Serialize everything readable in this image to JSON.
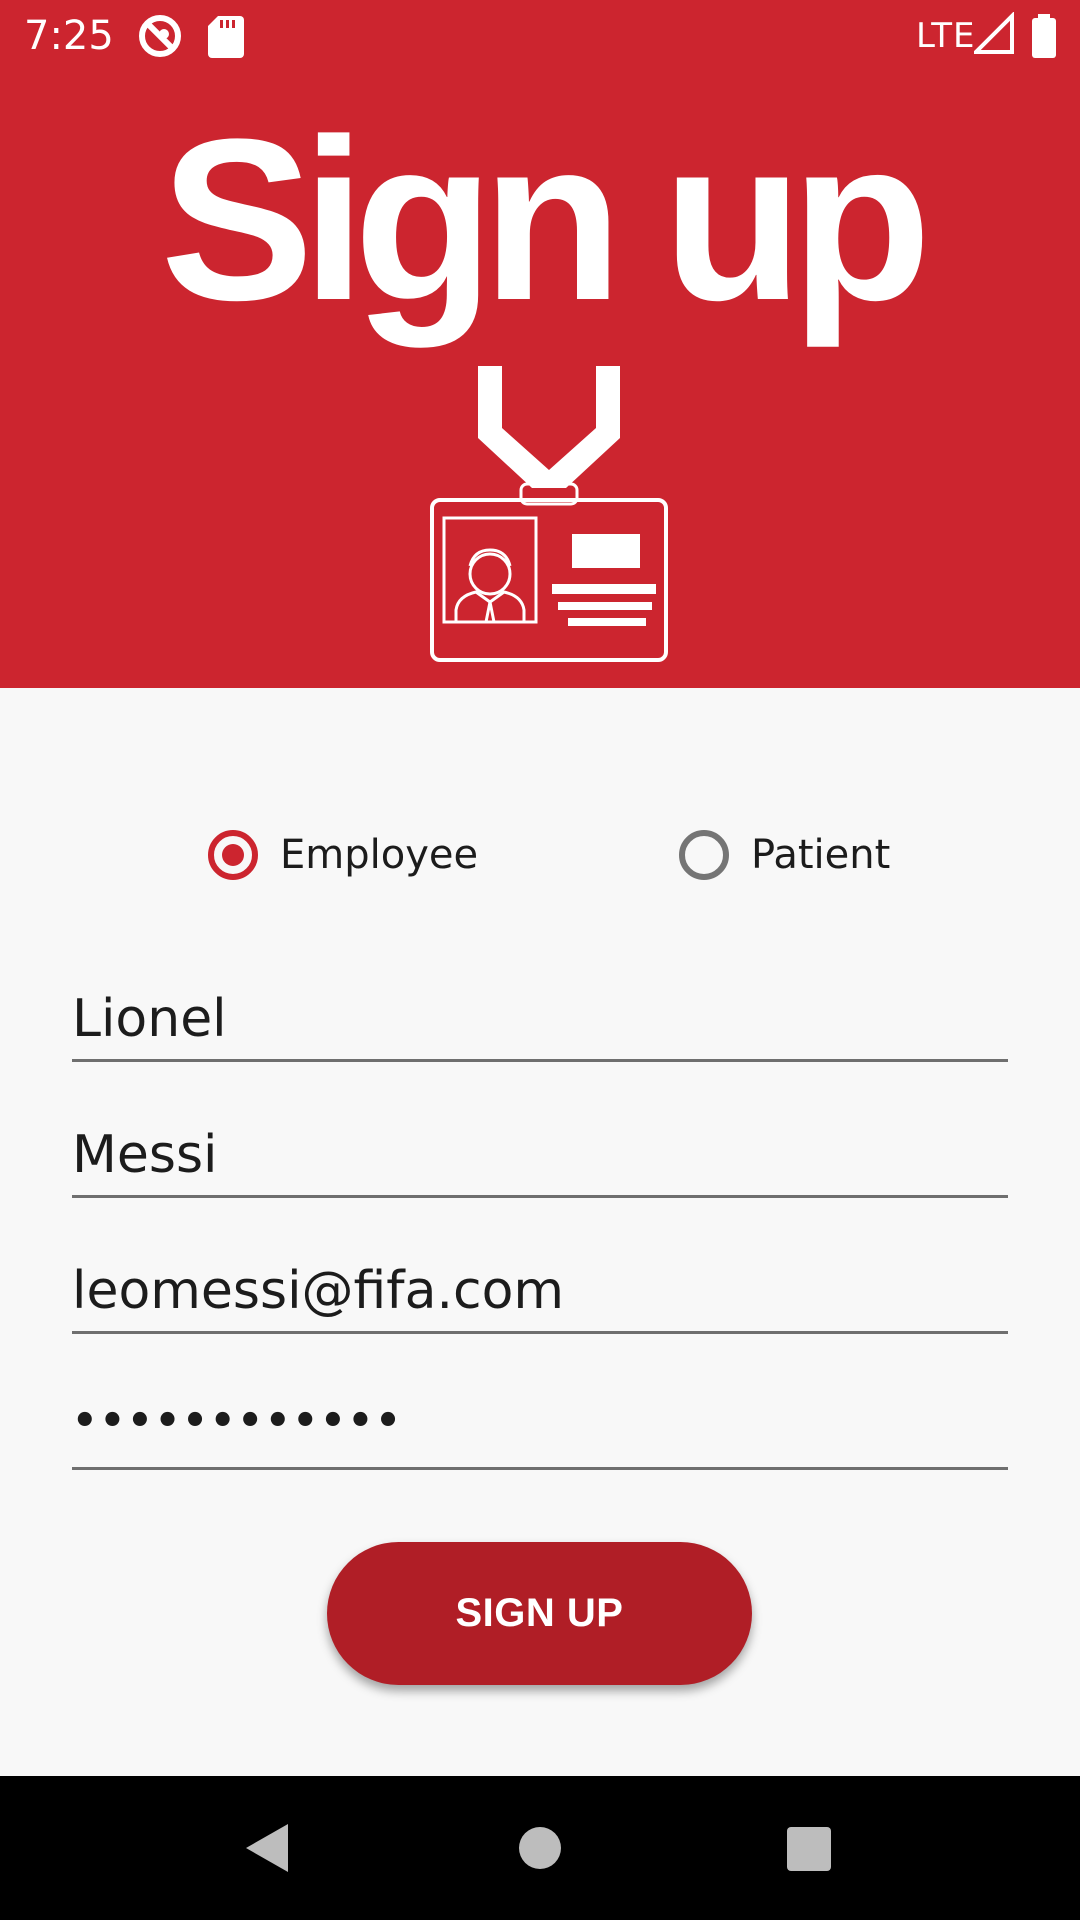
{
  "status_bar": {
    "time": "7:25",
    "network": "LTE"
  },
  "header": {
    "title": "Sign up",
    "background_color": "#cc252f"
  },
  "user_type": {
    "options": [
      {
        "label": "Employee",
        "selected": true
      },
      {
        "label": "Patient",
        "selected": false
      }
    ]
  },
  "form": {
    "first_name": "Lionel",
    "last_name": "Messi",
    "email": "leomessi@fifa.com",
    "password": "••••••••••••"
  },
  "submit_button": {
    "label": "SIGN UP",
    "color": "#b01e26"
  },
  "nav_bar": {
    "icons": [
      "back-icon",
      "home-icon",
      "recents-icon"
    ]
  }
}
